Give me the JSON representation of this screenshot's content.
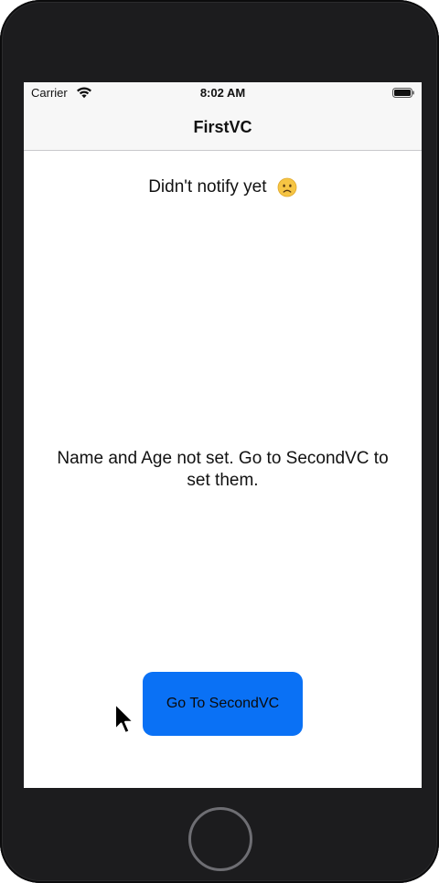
{
  "status_bar": {
    "carrier": "Carrier",
    "time": "8:02 AM",
    "wifi_icon": "wifi-icon",
    "battery_icon": "battery-icon"
  },
  "nav_bar": {
    "title": "FirstVC"
  },
  "content": {
    "notify_text": "Didn't notify yet",
    "notify_emoji_icon": "sad-face-emoji-icon",
    "info_text": "Name and Age not set. Go to SecondVC to set them.",
    "button_label": "Go To SecondVC"
  },
  "colors": {
    "button_background": "#0a71f5",
    "device_frame": "#1c1c1e",
    "nav_background": "#f7f7f7"
  }
}
